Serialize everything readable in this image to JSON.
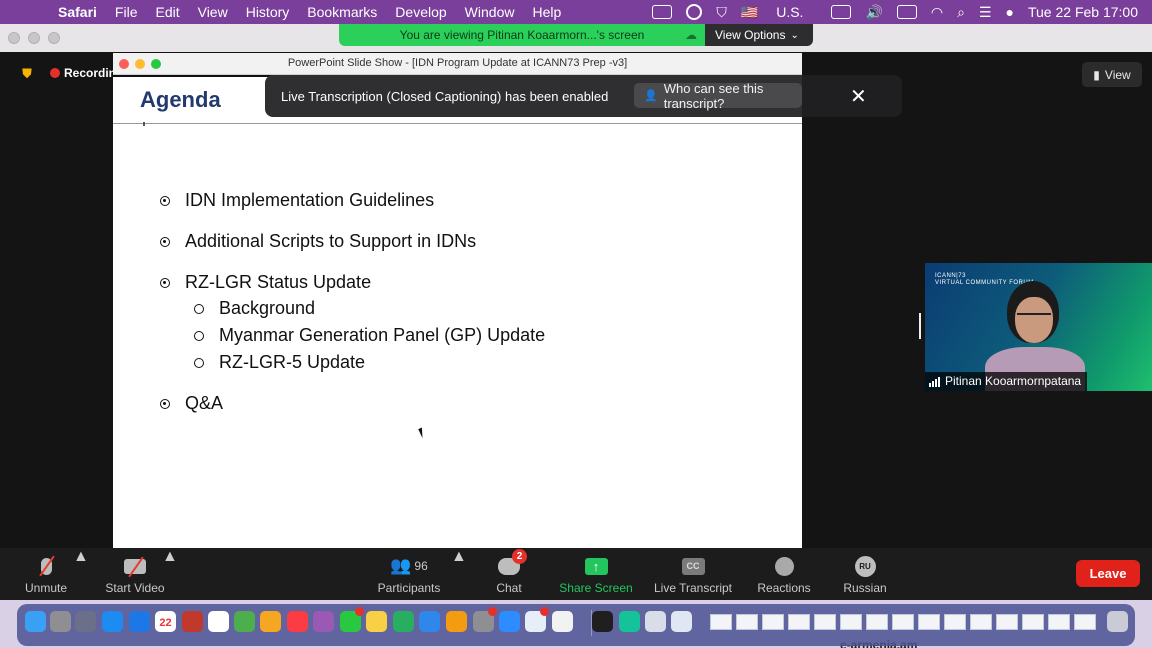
{
  "menubar": {
    "app": "Safari",
    "items": [
      "File",
      "Edit",
      "View",
      "History",
      "Bookmarks",
      "Develop",
      "Window",
      "Help"
    ],
    "input_source": "U.S.",
    "datetime": "Tue 22 Feb  17:00",
    "flag_text": "🇺🇸"
  },
  "share_banner": {
    "text": "You are viewing Pitinan Koaarmorn...'s screen",
    "view_options": "View Options"
  },
  "meeting": {
    "recording_label": "Recording",
    "view_label": "View"
  },
  "ppt": {
    "window_title": "PowerPoint Slide Show - [IDN Program Update at ICANN73 Prep -v3]",
    "slide_title": "Agenda",
    "bullets": [
      "IDN Implementation Guidelines",
      "Additional Scripts to Support in IDNs",
      "RZ-LGR Status Update",
      "Q&A"
    ],
    "sub_bullets": [
      "Background",
      "Myanmar Generation Panel (GP) Update",
      "RZ-LGR-5 Update"
    ]
  },
  "caption_toast": {
    "message": "Live Transcription (Closed Captioning) has been enabled",
    "who_button": "Who can see this transcript?",
    "close": "✕"
  },
  "speaker": {
    "name": "Pitinan Kooarmornpatana",
    "forum_line1": "ICANN|73",
    "forum_line2": "VIRTUAL COMMUNITY FORUM"
  },
  "toolbar": {
    "unmute": "Unmute",
    "start_video": "Start Video",
    "participants": "Participants",
    "participant_count": "96",
    "chat": "Chat",
    "chat_badge": "2",
    "share_screen": "Share Screen",
    "live_transcript": "Live Transcript",
    "cc_icon_text": "CC",
    "reactions": "Reactions",
    "language": "Russian",
    "language_code": "RU",
    "leave": "Leave"
  },
  "dock": {
    "calendar_day": "22",
    "overflow_text": "e-armenia.am"
  },
  "colors": {
    "menubar": "#7a3f9a",
    "share_green": "#2bd05a",
    "slide_title": "#223a6e",
    "leave_red": "#e0221b",
    "share_screen_green": "#22c55e"
  }
}
